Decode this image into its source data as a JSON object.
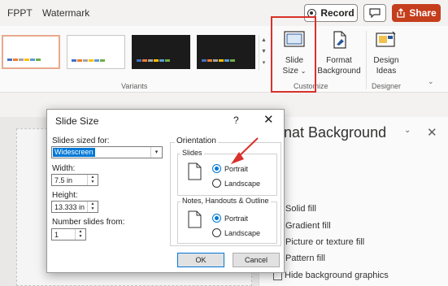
{
  "tabs": [
    "FPPT",
    "Watermark"
  ],
  "topbar": {
    "record_label": "Record",
    "share_label": "Share"
  },
  "ribbon": {
    "group_variants": "Variants",
    "group_customize": "Customize",
    "group_designer": "Designer",
    "slide_size": [
      "Slide",
      "Size"
    ],
    "slide_size_caret": "⌄",
    "format_background": [
      "Format",
      "Background"
    ],
    "design_ideas": [
      "Design",
      "Ideas"
    ],
    "collapse_caret": "⌄",
    "gallery_arrows": [
      "▲",
      "▼",
      "▾"
    ]
  },
  "colors": {
    "accent": "#0078d7",
    "share": "#c43e1c",
    "highlight": "#d9312b",
    "palette": [
      "#4472c4",
      "#ed7d31",
      "#a5a5a5",
      "#ffc000",
      "#5b9bd5",
      "#70ad47"
    ]
  },
  "format_pane": {
    "title": "nat Background",
    "caret": "⌄",
    "close": "✕",
    "options": [
      {
        "label": "Solid fill",
        "type": "radio"
      },
      {
        "label": "Gradient fill",
        "type": "radio"
      },
      {
        "label": "Picture or texture fill",
        "type": "radio"
      },
      {
        "label": "Pattern fill",
        "type": "radio"
      },
      {
        "label": "Hide background graphics",
        "type": "checkbox"
      }
    ]
  },
  "dialog": {
    "title": "Slide Size",
    "help": "?",
    "close": "✕",
    "sized_for_label": "Slides sized for:",
    "sized_for_value": "Widescreen",
    "sized_for_caret": "▾",
    "width_label": "Width:",
    "width_value": "7.5 in",
    "height_label": "Height:",
    "height_value": "13.333 in",
    "number_from_label": "Number slides from:",
    "number_from_value": "1",
    "spin_arrows": [
      "▲",
      "▼"
    ],
    "orientation_label": "Orientation",
    "slides_label": "Slides",
    "notes_label": "Notes, Handouts & Outline",
    "portrait": "Portrait",
    "landscape": "Landscape",
    "slides_orientation": "Portrait",
    "notes_orientation": "Portrait",
    "ok": "OK",
    "cancel": "Cancel"
  }
}
